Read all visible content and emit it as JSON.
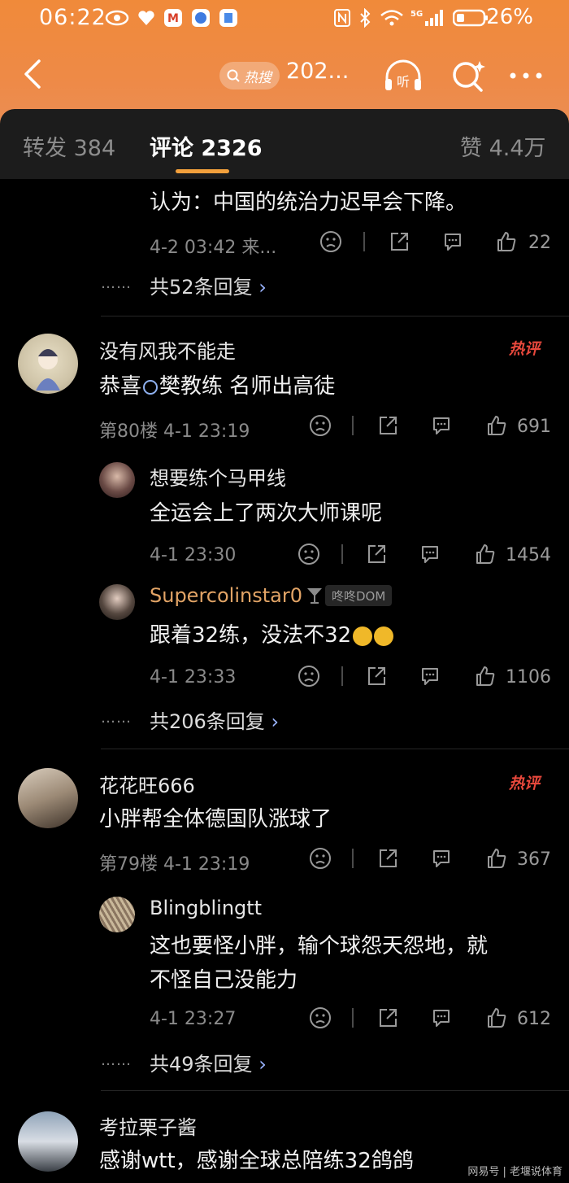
{
  "status_bar": {
    "time": "06:22",
    "battery": "26%"
  },
  "nav": {
    "hot_label": "热搜",
    "title": "202..."
  },
  "tabs": [
    {
      "label": "转发 384"
    },
    {
      "label": "评论 2326"
    },
    {
      "label": "赞 4.4万"
    }
  ],
  "comments": [
    {
      "text": "认为：中国的统治力迟早会下降。",
      "meta": "4-2 03:42 来...",
      "likes": "22",
      "more": "共52条回复"
    },
    {
      "author": "没有风我不能走",
      "text_before": "恭喜",
      "text_link": "樊教练",
      "text_after": " 名师出高徒",
      "meta": "第80楼 4-1 23:19",
      "likes": "691",
      "badge": "热评",
      "replies": [
        {
          "author": "想要练个马甲线",
          "text": "全运会上了两次大师课呢",
          "meta": "4-1 23:30",
          "likes": "1454"
        },
        {
          "author": "Supercolinstar0",
          "chip": "咚咚DOM",
          "text": "跟着32练，没法不32",
          "meta": "4-1 23:33",
          "likes": "1106"
        }
      ],
      "more": "共206条回复"
    },
    {
      "author": "花花旺666",
      "text": "小胖帮全体德国队涨球了",
      "meta": "第79楼 4-1 23:19",
      "likes": "367",
      "badge": "热评",
      "replies": [
        {
          "author": "Blingblingtt",
          "text_line1": "这也要怪小胖，输个球怨天怨地，就",
          "text_line2": "不怪自己没能力",
          "meta": "4-1 23:27",
          "likes": "612"
        }
      ],
      "more": "共49条回复"
    },
    {
      "author": "考拉栗子酱",
      "text": "感谢wtt，感谢全球总陪练32鸽鸽"
    }
  ],
  "watermark": "网易号 | 老堰说体育",
  "colors": {
    "header_gradient_top": "#f08a3a",
    "accent": "#f3a03c",
    "hot_badge": "#e8483c",
    "link_blue": "#8fb1f0",
    "background": "#000000"
  }
}
